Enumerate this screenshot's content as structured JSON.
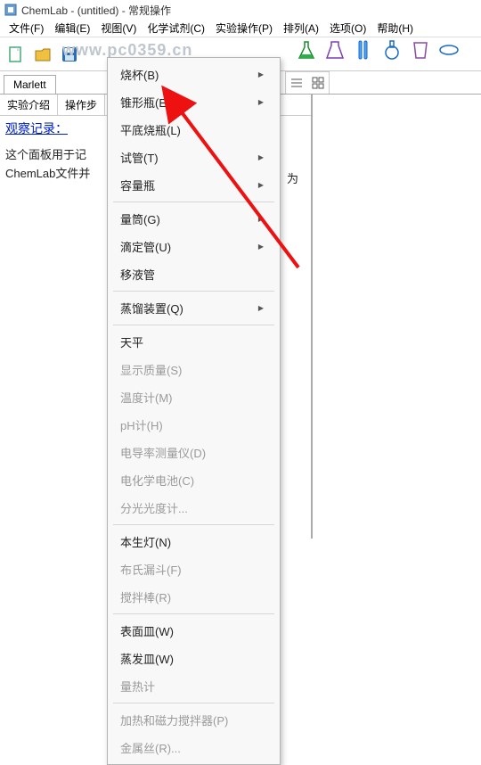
{
  "window": {
    "title": "ChemLab - (untitled) - 常规操作"
  },
  "menubar": {
    "file": "文件(F)",
    "edit": "编辑(E)",
    "view": "视图(V)",
    "reagent": "化学试剂(C)",
    "operate": "实验操作(P)",
    "arrange": "排列(A)",
    "options": "选项(O)",
    "help": "帮助(H)"
  },
  "watermark": "www.pc0359.cn",
  "tabs": {
    "main": "Marlett"
  },
  "panel": {
    "tab_intro": "实验介绍",
    "tab_steps": "操作步",
    "obs_title": "观察记录：",
    "obs_line1": "这个面板用于记",
    "obs_line2": "ChemLab文件并",
    "obs_right": "为"
  },
  "menu": {
    "items": [
      {
        "label": "烧杯(B)",
        "sub": true
      },
      {
        "label": "锥形瓶(E)",
        "sub": true
      },
      {
        "label": "平底烧瓶(L)"
      },
      {
        "label": "试管(T)",
        "sub": true
      },
      {
        "label": "容量瓶",
        "sub": true
      },
      {
        "sep": true
      },
      {
        "label": "量筒(G)",
        "sub": true
      },
      {
        "label": "滴定管(U)",
        "sub": true
      },
      {
        "label": "移液管"
      },
      {
        "sep": true
      },
      {
        "label": "蒸馏装置(Q)",
        "sub": true
      },
      {
        "sep": true
      },
      {
        "label": "天平"
      },
      {
        "label": "显示质量(S)",
        "disabled": true
      },
      {
        "label": "温度计(M)",
        "disabled": true
      },
      {
        "label": "pH计(H)",
        "disabled": true
      },
      {
        "label": "电导率测量仪(D)",
        "disabled": true
      },
      {
        "label": "电化学电池(C)",
        "disabled": true
      },
      {
        "label": "分光光度计...",
        "disabled": true
      },
      {
        "sep": true
      },
      {
        "label": "本生灯(N)"
      },
      {
        "label": "布氏漏斗(F)",
        "disabled": true
      },
      {
        "label": "搅拌棒(R)",
        "disabled": true
      },
      {
        "sep": true
      },
      {
        "label": "表面皿(W)"
      },
      {
        "label": "蒸发皿(W)"
      },
      {
        "label": "量热计",
        "disabled": true
      },
      {
        "sep": true
      },
      {
        "label": "加热和磁力搅拌器(P)",
        "disabled": true
      },
      {
        "label": "金属丝(R)...",
        "disabled": true
      }
    ]
  }
}
